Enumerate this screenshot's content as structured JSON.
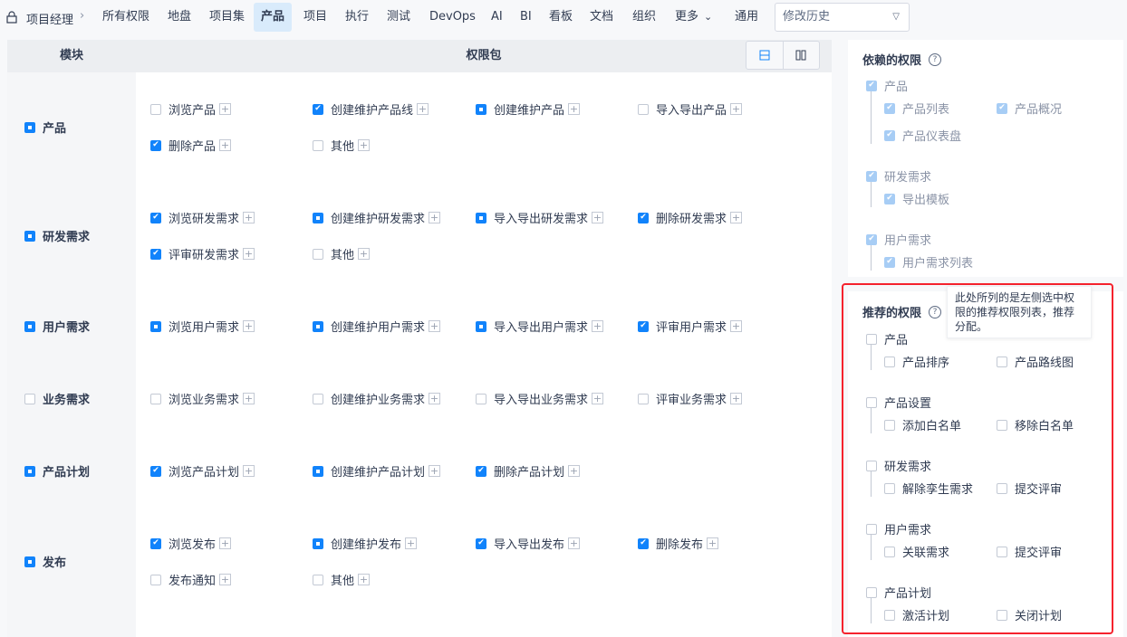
{
  "nav": {
    "breadcrumb": "项目经理",
    "tabs": [
      "所有权限",
      "地盘",
      "项目集",
      "产品",
      "项目",
      "执行",
      "测试",
      "DevOps",
      "AI",
      "BI",
      "看板",
      "文档",
      "组织",
      "更多",
      "通用"
    ],
    "active_tab": "产品",
    "more_chevron": "⌄",
    "history_select": "修改历史"
  },
  "table": {
    "col_module": "模块",
    "col_packages": "权限包",
    "plus": "+"
  },
  "modules": [
    {
      "name": "产品",
      "state": "partial",
      "items": [
        {
          "label": "浏览产品",
          "state": "unchecked"
        },
        {
          "label": "创建维护产品线",
          "state": "checked"
        },
        {
          "label": "创建维护产品",
          "state": "partial"
        },
        {
          "label": "导入导出产品",
          "state": "unchecked"
        },
        {
          "label": "删除产品",
          "state": "checked"
        },
        {
          "label": "其他",
          "state": "unchecked"
        }
      ]
    },
    {
      "name": "研发需求",
      "state": "partial",
      "items": [
        {
          "label": "浏览研发需求",
          "state": "checked"
        },
        {
          "label": "创建维护研发需求",
          "state": "partial"
        },
        {
          "label": "导入导出研发需求",
          "state": "partial"
        },
        {
          "label": "删除研发需求",
          "state": "checked"
        },
        {
          "label": "评审研发需求",
          "state": "checked"
        },
        {
          "label": "其他",
          "state": "unchecked"
        }
      ]
    },
    {
      "name": "用户需求",
      "state": "partial",
      "items": [
        {
          "label": "浏览用户需求",
          "state": "partial"
        },
        {
          "label": "创建维护用户需求",
          "state": "partial"
        },
        {
          "label": "导入导出用户需求",
          "state": "partial"
        },
        {
          "label": "评审用户需求",
          "state": "checked"
        }
      ]
    },
    {
      "name": "业务需求",
      "state": "unchecked",
      "items": [
        {
          "label": "浏览业务需求",
          "state": "unchecked"
        },
        {
          "label": "创建维护业务需求",
          "state": "unchecked"
        },
        {
          "label": "导入导出业务需求",
          "state": "unchecked"
        },
        {
          "label": "评审业务需求",
          "state": "unchecked"
        }
      ]
    },
    {
      "name": "产品计划",
      "state": "partial",
      "items": [
        {
          "label": "浏览产品计划",
          "state": "checked"
        },
        {
          "label": "创建维护产品计划",
          "state": "partial"
        },
        {
          "label": "删除产品计划",
          "state": "checked"
        }
      ]
    },
    {
      "name": "发布",
      "state": "partial",
      "items": [
        {
          "label": "浏览发布",
          "state": "checked"
        },
        {
          "label": "创建维护发布",
          "state": "partial"
        },
        {
          "label": "导入导出发布",
          "state": "checked"
        },
        {
          "label": "删除发布",
          "state": "checked"
        },
        {
          "label": "发布通知",
          "state": "unchecked"
        },
        {
          "label": "其他",
          "state": "unchecked"
        }
      ]
    }
  ],
  "dependent": {
    "title": "依赖的权限",
    "help": "?",
    "groups": [
      {
        "name": "产品",
        "items": [
          "产品列表",
          "产品概况",
          "产品仪表盘"
        ]
      },
      {
        "name": "研发需求",
        "items": [
          "导出模板"
        ]
      },
      {
        "name": "用户需求",
        "items": [
          "用户需求列表"
        ]
      }
    ]
  },
  "recommended": {
    "title": "推荐的权限",
    "help": "?",
    "tooltip": "此处所列的是左侧选中权限的推荐权限列表，推荐分配。",
    "groups": [
      {
        "name": "产品",
        "items": [
          "产品排序",
          "产品路线图"
        ]
      },
      {
        "name": "产品设置",
        "items": [
          "添加白名单",
          "移除白名单"
        ]
      },
      {
        "name": "研发需求",
        "items": [
          "解除孪生需求",
          "提交评审"
        ]
      },
      {
        "name": "用户需求",
        "items": [
          "关联需求",
          "提交评审"
        ]
      },
      {
        "name": "产品计划",
        "items": [
          "激活计划",
          "关闭计划"
        ]
      }
    ]
  }
}
